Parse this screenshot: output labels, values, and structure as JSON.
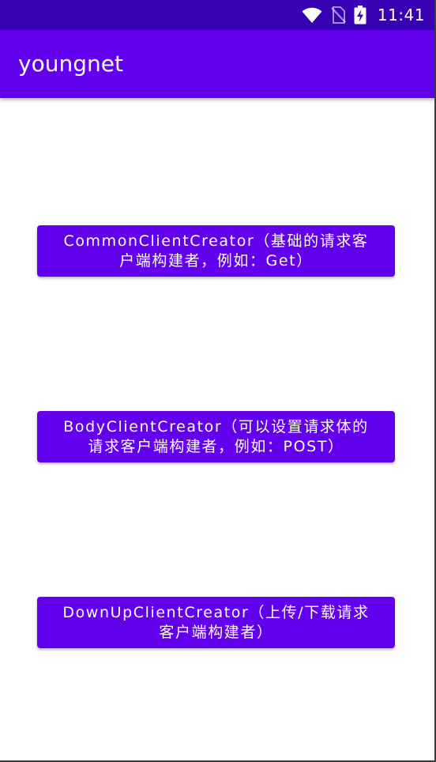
{
  "status_bar": {
    "time": "11:41",
    "icons": [
      "wifi-icon",
      "no-sim-icon",
      "battery-charging-icon"
    ],
    "background": "#3700b3"
  },
  "app_bar": {
    "title": "youngnet",
    "background": "#6200ee"
  },
  "buttons": [
    {
      "label": "CommonClientCreator（基础的请求客户端构建者，例如：Get）"
    },
    {
      "label": "BodyClientCreator（可以设置请求体的请求客户端构建者，例如：POST）"
    },
    {
      "label": "DownUpClientCreator（上传/下载请求客户端构建者）"
    }
  ],
  "colors": {
    "primary": "#6200ee",
    "primary_dark": "#3700b3",
    "on_primary": "#ffffff",
    "background": "#ffffff"
  }
}
